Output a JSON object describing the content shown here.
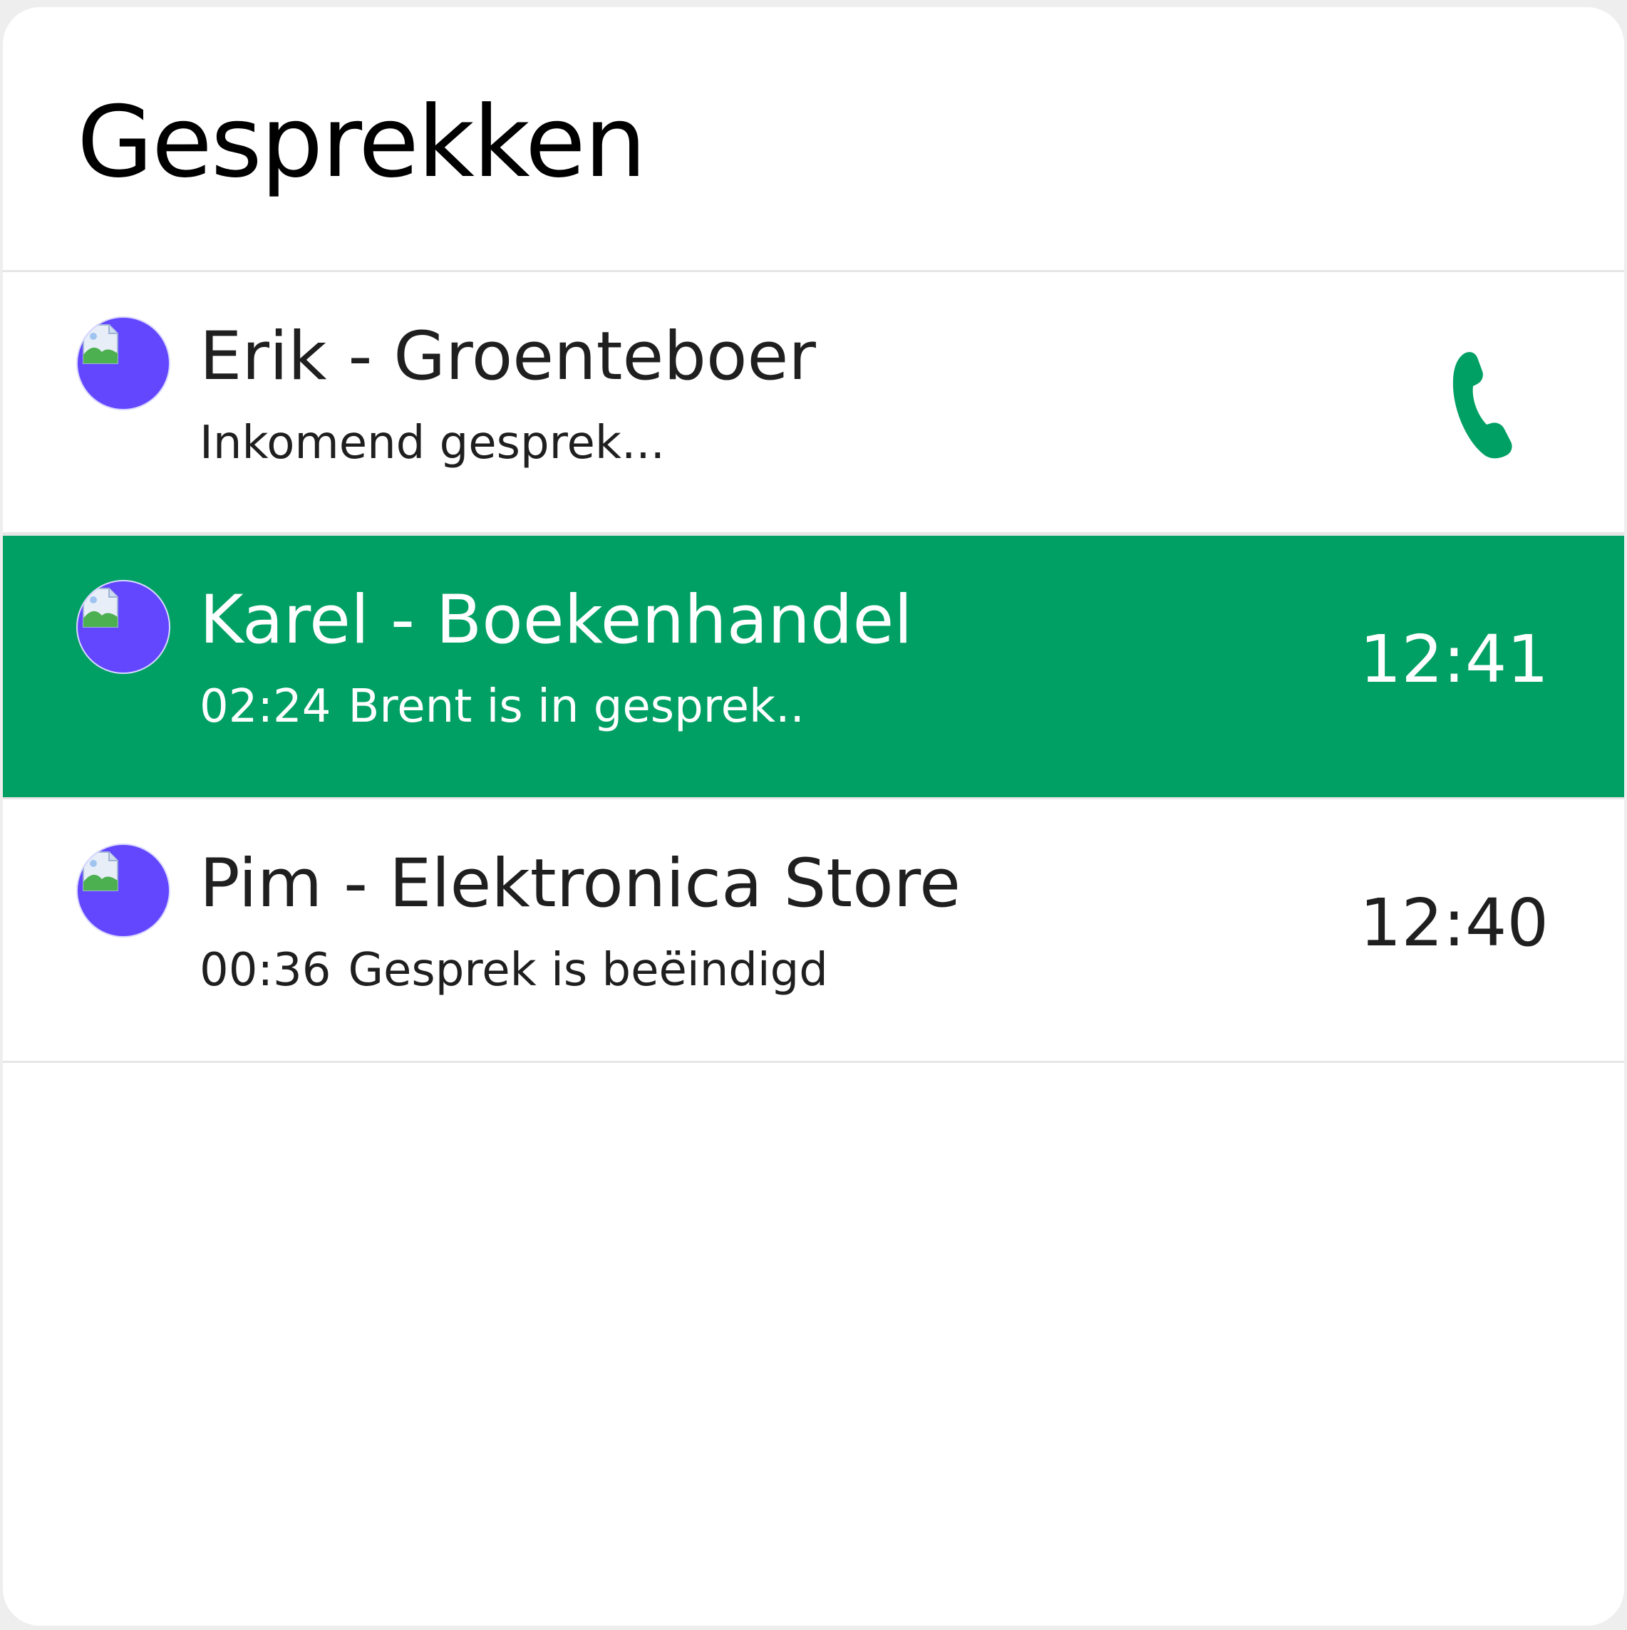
{
  "header": {
    "title": "Gesprekken"
  },
  "colors": {
    "accent_green": "#00a064",
    "avatar_purple": "#6247ff",
    "call_icon_green": "#00a064"
  },
  "conversations": [
    {
      "name": "Erik - Groenteboer",
      "status": "Inkomend gesprek...",
      "duration": "",
      "time": "",
      "icon": "phone-icon",
      "active": false
    },
    {
      "name": "Karel - Boekenhandel",
      "status": "Brent is in gesprek..",
      "duration": "02:24",
      "time": "12:41",
      "active": true
    },
    {
      "name": "Pim - Elektronica Store",
      "status": "Gesprek is beëindigd",
      "duration": "00:36",
      "time": "12:40",
      "active": false
    }
  ]
}
